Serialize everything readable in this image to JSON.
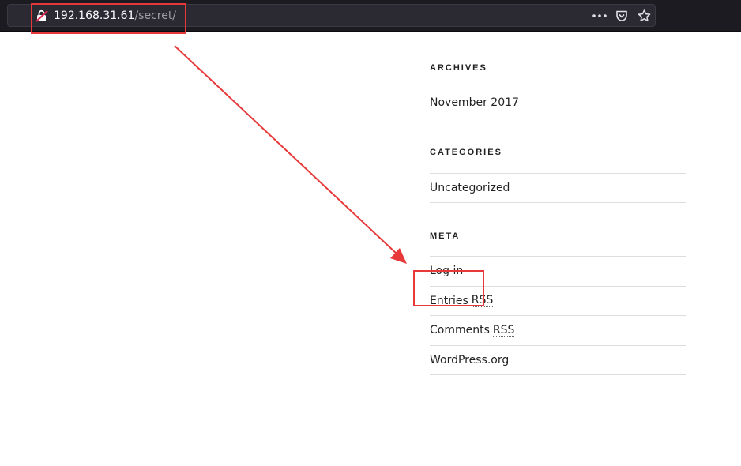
{
  "browser": {
    "url_host": "192.168.31.61",
    "url_path": "/secret/",
    "icons": [
      "shield-icon",
      "insecure-lock-icon",
      "more-actions-icon",
      "pocket-icon",
      "bookmark-star-icon"
    ],
    "accent_colors": {
      "toolbar_bg": "#1c1b22",
      "urlbar_bg": "#2b2a33",
      "insecure_lock": "#e22850"
    }
  },
  "sidebar": {
    "archives": {
      "title": "ARCHIVES",
      "items": [
        {
          "label": "November 2017"
        }
      ]
    },
    "categories": {
      "title": "CATEGORIES",
      "items": [
        {
          "label": "Uncategorized"
        }
      ]
    },
    "meta": {
      "title": "META",
      "items": [
        {
          "label": "Log in"
        },
        {
          "label": "Entries",
          "abbr": "RSS"
        },
        {
          "label": "Comments",
          "abbr": "RSS"
        },
        {
          "label": "WordPress.org"
        }
      ]
    }
  },
  "annotation": {
    "color": "#e8393a",
    "targets": [
      "url-bar",
      "log-in-link"
    ]
  }
}
